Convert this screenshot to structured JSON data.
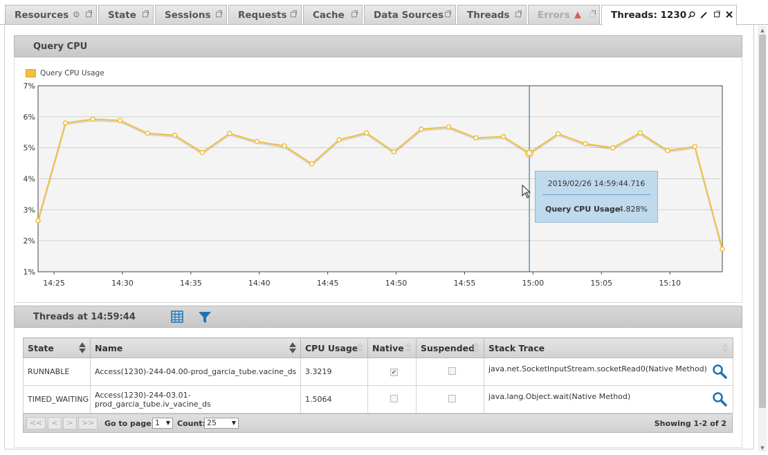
{
  "tabs": [
    {
      "label": "Resources",
      "state": "normal"
    },
    {
      "label": "State",
      "state": "normal"
    },
    {
      "label": "Sessions",
      "state": "normal"
    },
    {
      "label": "Requests",
      "state": "normal"
    },
    {
      "label": "Cache",
      "state": "normal"
    },
    {
      "label": "Data Sources",
      "state": "normal"
    },
    {
      "label": "Threads",
      "state": "normal"
    },
    {
      "label": "Errors",
      "state": "disabled"
    },
    {
      "label": "Threads: 1230",
      "state": "active"
    }
  ],
  "query_cpu_panel": {
    "title": "Query CPU"
  },
  "chart_data": {
    "type": "line",
    "title": "",
    "xlabel": "",
    "ylabel": "",
    "legend": "top-left",
    "grid": true,
    "series": [
      {
        "name": "Query CPU Usage",
        "color": "#f0c040",
        "x": [
          "14:23:50",
          "14:25:50",
          "14:27:50",
          "14:29:50",
          "14:31:50",
          "14:33:50",
          "14:35:50",
          "14:37:50",
          "14:39:50",
          "14:41:50",
          "14:43:50",
          "14:45:50",
          "14:47:50",
          "14:49:50",
          "14:51:50",
          "14:53:50",
          "14:55:50",
          "14:57:50",
          "14:59:44",
          "15:01:50",
          "15:03:50",
          "15:05:50",
          "15:07:50",
          "15:09:50",
          "15:11:50",
          "15:13:50"
        ],
        "values": [
          2.65,
          5.8,
          5.92,
          5.88,
          5.47,
          5.4,
          4.85,
          5.46,
          5.2,
          5.06,
          4.48,
          5.26,
          5.48,
          4.87,
          5.6,
          5.67,
          5.32,
          5.36,
          4.83,
          5.45,
          5.13,
          5.0,
          5.48,
          4.91,
          5.04,
          1.73
        ]
      }
    ],
    "y_ticks": [
      "7%",
      "6%",
      "5%",
      "4%",
      "3%",
      "2%",
      "1%"
    ],
    "ylim": [
      1,
      7
    ],
    "x_ticks": [
      "14:25",
      "14:30",
      "14:35",
      "14:40",
      "14:45",
      "14:50",
      "14:55",
      "15:00",
      "15:05",
      "15:10"
    ],
    "xlim": [
      "14:23:50",
      "15:13:50"
    ],
    "highlight_index": 18
  },
  "tooltip": {
    "timestamp": "2019/02/26 14:59:44.716",
    "series_name": "Query CPU Usage",
    "value": "4.828%"
  },
  "threads_panel": {
    "title": "Threads at 14:59:44"
  },
  "grid": {
    "columns": [
      "State",
      "Name",
      "CPU Usage",
      "Native",
      "Suspended",
      "Stack Trace"
    ],
    "rows": [
      {
        "state": "RUNNABLE",
        "name": "Access(1230)-244-04.00-prod_garcia_tube.vacine_ds",
        "cpu": "3.3219",
        "native": true,
        "suspended": false,
        "stack": "java.net.SocketInputStream.socketRead0(Native Method)"
      },
      {
        "state": "TIMED_WAITING",
        "name": "Access(1230)-244-03.01-prod_garcia_tube.iv_vacine_ds",
        "cpu": "1.5064",
        "native": false,
        "suspended": false,
        "stack": "java.lang.Object.wait(Native Method)"
      }
    ]
  },
  "pager": {
    "first": "<<",
    "prev": "<",
    "next": ">",
    "last": ">>",
    "goto_label": "Go to page:",
    "page_value": "1",
    "count_label": "Count:",
    "count_value": "25",
    "showing": "Showing 1-2 of 2"
  },
  "colors": {
    "series": "#f0c040",
    "crosshair": "#1f5f8b",
    "accent_blue": "#1b74b8"
  }
}
